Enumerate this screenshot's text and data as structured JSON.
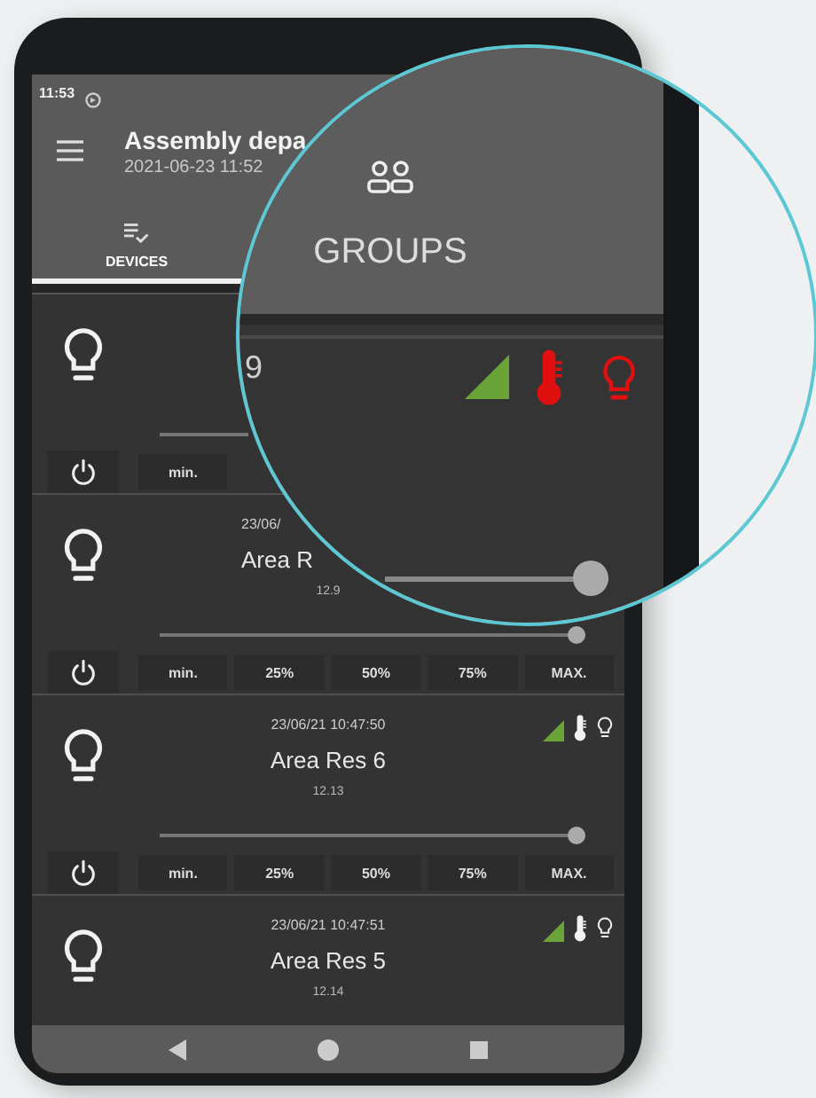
{
  "status_bar": {
    "time": "11:53"
  },
  "header": {
    "title": "Assembly depa",
    "subtitle": "2021-06-23 11:52"
  },
  "tabs": [
    {
      "label": "DEVICES",
      "selected": true
    }
  ],
  "devices": [
    {
      "partial": true,
      "buttons": [
        "min."
      ]
    },
    {
      "date": "23/06/",
      "name": "Area R",
      "value": "12.9",
      "partial": true,
      "level": 1,
      "buttons": [
        "min.",
        "25%",
        "50%",
        "75%",
        "MAX."
      ]
    },
    {
      "date": "23/06/21  10:47:50",
      "name": "Area Res 6",
      "value": "12.13",
      "partial": false,
      "alarm": false,
      "level": 1,
      "buttons": [
        "min.",
        "25%",
        "50%",
        "75%",
        "MAX."
      ]
    },
    {
      "date": "23/06/21  10:47:51",
      "name": "Area Res 5",
      "value": "12.14",
      "partial": false,
      "alarm": false
    }
  ],
  "magnifier": {
    "tab": {
      "label": "GROUPS",
      "selected": false
    },
    "partial_text": "9",
    "alarm": true,
    "level": 1
  }
}
